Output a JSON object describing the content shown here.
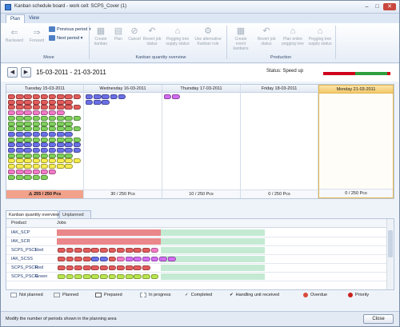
{
  "window": {
    "title": "Kanban schedule board - work cell: SCPS_Cover (1)"
  },
  "ribbon": {
    "tabs": [
      "Plan",
      "View"
    ],
    "move": {
      "backward": "Backward",
      "forward": "Forward",
      "previous_period": "Previous period",
      "next_period": "Next period",
      "group": "Move"
    },
    "kanban": {
      "create": "Create kanban",
      "plan": "Plan",
      "cancel": "Cancel",
      "revert": "Revert job status",
      "pegging": "Pegging tree supply status",
      "alternative": "Use alternative Kanban rule",
      "group": "Kanban quantity overview"
    },
    "production": {
      "create_event": "Create event kanbans",
      "revert": "Revert job status",
      "plan_entire": "Plan entire pegging tree",
      "pegging": "Pegging tree supply status",
      "group": "Production"
    }
  },
  "period": {
    "range": "15-03-2011 - 21-03-2011",
    "status_label": "Status: Speed up",
    "status_colors": [
      "#d0021b",
      "#d0021b",
      "#2e9e3e",
      "#2e9e3e",
      "#d0021b"
    ]
  },
  "days": [
    {
      "label": "Tuesday 15-03-2011",
      "total": "255 / 250 Pcs",
      "over": true
    },
    {
      "label": "Wednesday 16-03-2011",
      "total": "30 / 250 Pcs",
      "over": false
    },
    {
      "label": "Thursday 17-03-2011",
      "total": "10 / 250 Pcs",
      "over": false
    },
    {
      "label": "Friday 18-03-2011",
      "total": "0 / 250 Pcs",
      "over": false
    },
    {
      "label": "Monday 21-03-2011",
      "total": "0 / 250 Pcs",
      "over": false,
      "today": true
    }
  ],
  "colors": {
    "red": "#e35b5b",
    "pink": "#f47ac8",
    "blue": "#6a6fe8",
    "green": "#7fd05c",
    "lime": "#b9e64f",
    "yellow": "#f5ec4f",
    "violet": "#d36cf2",
    "pale_red": "#e9878a",
    "pale_green": "#c4ead3"
  },
  "bottom_tabs": [
    "Kanban quantity overview",
    "Unplanned"
  ],
  "overview": {
    "headers": [
      "Product",
      "Jobs"
    ],
    "rows": [
      {
        "product": "IAK_SCP",
        "color": ""
      },
      {
        "product": "IAK_SCR",
        "color": ""
      },
      {
        "product": "SCPS_PSCL",
        "color": "Red"
      },
      {
        "product": "IAK_SCSS",
        "color": ""
      },
      {
        "product": "SCPS_PSCR",
        "color": "Red"
      },
      {
        "product": "SCPS_PSCR",
        "color": "Green"
      }
    ]
  },
  "legend": [
    "Not planned",
    "Planned",
    "Prepared",
    "In progress",
    "Completed",
    "Handling unit received",
    "Overdue",
    "Priority"
  ],
  "statusbar": {
    "message": "Modify the number of periods shown in the planning area",
    "close": "Close"
  }
}
